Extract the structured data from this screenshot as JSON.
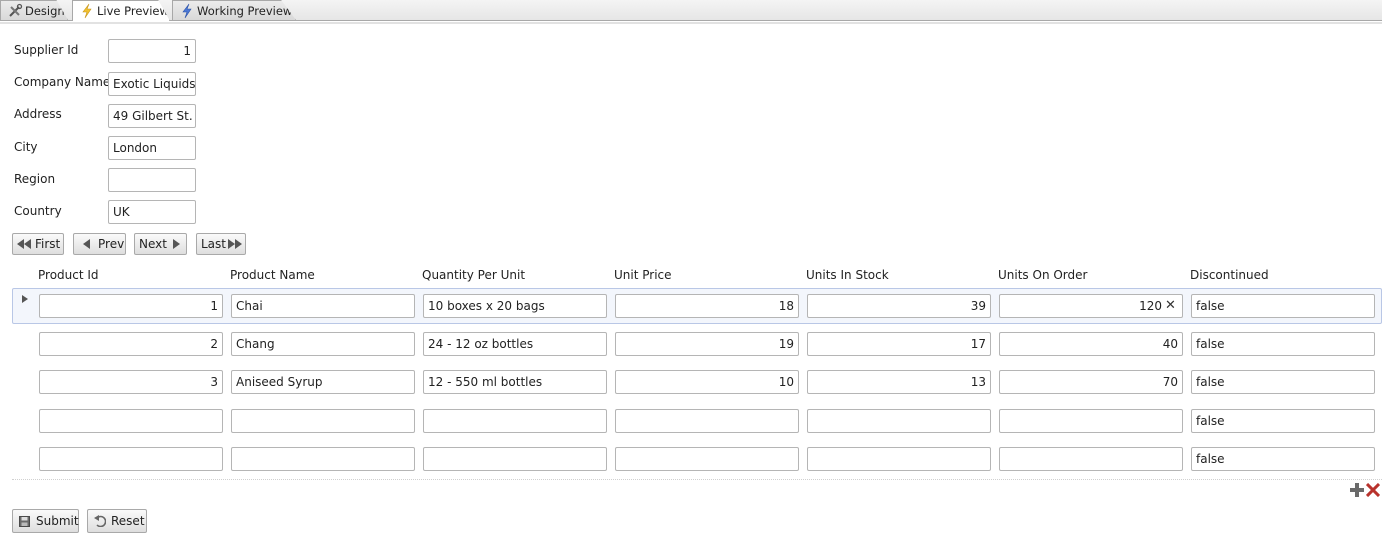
{
  "tabs": [
    {
      "label": "Design",
      "icon": "tools-icon"
    },
    {
      "label": "Live Preview",
      "icon": "lightning-icon"
    },
    {
      "label": "Working Preview",
      "icon": "lightning-blue-icon"
    }
  ],
  "form": {
    "supplier_id": {
      "label": "Supplier Id",
      "value": "1"
    },
    "company_name": {
      "label": "Company Name",
      "value": "Exotic Liquids"
    },
    "address": {
      "label": "Address",
      "value": "49 Gilbert St."
    },
    "city": {
      "label": "City",
      "value": "London"
    },
    "region": {
      "label": "Region",
      "value": ""
    },
    "country": {
      "label": "Country",
      "value": "UK"
    }
  },
  "nav": {
    "first": "First",
    "prev": "Prev",
    "next": "Next",
    "last": "Last"
  },
  "grid": {
    "columns": [
      "Product Id",
      "Product Name",
      "Quantity Per Unit",
      "Unit Price",
      "Units In Stock",
      "Units On Order",
      "Discontinued"
    ],
    "rows": [
      [
        "1",
        "Chai",
        "10 boxes x 20 bags",
        "18",
        "39",
        "120",
        "false"
      ],
      [
        "2",
        "Chang",
        "24 - 12 oz bottles",
        "19",
        "17",
        "40",
        "false"
      ],
      [
        "3",
        "Aniseed Syrup",
        "12 - 550 ml bottles",
        "10",
        "13",
        "70",
        "false"
      ],
      [
        "",
        "",
        "",
        "",
        "",
        "",
        "false"
      ],
      [
        "",
        "",
        "",
        "",
        "",
        "",
        "false"
      ]
    ],
    "clear_glyph": "✕"
  },
  "actions": {
    "submit": "Submit",
    "reset": "Reset"
  },
  "colors": {
    "selected_row": "#f3f6fc",
    "border": "#b5b5b5",
    "add_icon": "#6a6a6a",
    "delete_icon": "#b8322c"
  }
}
